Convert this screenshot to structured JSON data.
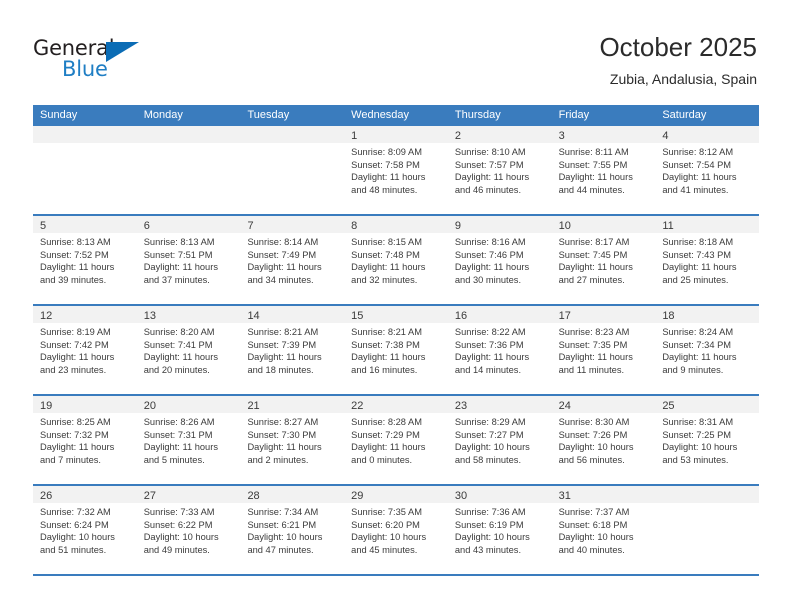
{
  "brand": {
    "name_top": "General",
    "name_bottom": "Blue",
    "triangle_icon": "triangle-icon",
    "color_dark": "#231f20",
    "color_blue": "#1f7ec4"
  },
  "header": {
    "title": "October 2025",
    "subtitle": "Zubia, Andalusia, Spain"
  },
  "theme": {
    "header_blue": "#3a7cbe",
    "daynum_strip": "#f2f2f2",
    "text": "#3b3b3b"
  },
  "weekdays": [
    "Sunday",
    "Monday",
    "Tuesday",
    "Wednesday",
    "Thursday",
    "Friday",
    "Saturday"
  ],
  "labels": {
    "sunrise": "Sunrise:",
    "sunset": "Sunset:",
    "daylight": "Daylight:"
  },
  "weeks": [
    [
      {
        "day": "",
        "lines": []
      },
      {
        "day": "",
        "lines": []
      },
      {
        "day": "",
        "lines": []
      },
      {
        "day": "1",
        "lines": [
          "Sunrise: 8:09 AM",
          "Sunset: 7:58 PM",
          "Daylight: 11 hours and 48 minutes."
        ]
      },
      {
        "day": "2",
        "lines": [
          "Sunrise: 8:10 AM",
          "Sunset: 7:57 PM",
          "Daylight: 11 hours and 46 minutes."
        ]
      },
      {
        "day": "3",
        "lines": [
          "Sunrise: 8:11 AM",
          "Sunset: 7:55 PM",
          "Daylight: 11 hours and 44 minutes."
        ]
      },
      {
        "day": "4",
        "lines": [
          "Sunrise: 8:12 AM",
          "Sunset: 7:54 PM",
          "Daylight: 11 hours and 41 minutes."
        ]
      }
    ],
    [
      {
        "day": "5",
        "lines": [
          "Sunrise: 8:13 AM",
          "Sunset: 7:52 PM",
          "Daylight: 11 hours and 39 minutes."
        ]
      },
      {
        "day": "6",
        "lines": [
          "Sunrise: 8:13 AM",
          "Sunset: 7:51 PM",
          "Daylight: 11 hours and 37 minutes."
        ]
      },
      {
        "day": "7",
        "lines": [
          "Sunrise: 8:14 AM",
          "Sunset: 7:49 PM",
          "Daylight: 11 hours and 34 minutes."
        ]
      },
      {
        "day": "8",
        "lines": [
          "Sunrise: 8:15 AM",
          "Sunset: 7:48 PM",
          "Daylight: 11 hours and 32 minutes."
        ]
      },
      {
        "day": "9",
        "lines": [
          "Sunrise: 8:16 AM",
          "Sunset: 7:46 PM",
          "Daylight: 11 hours and 30 minutes."
        ]
      },
      {
        "day": "10",
        "lines": [
          "Sunrise: 8:17 AM",
          "Sunset: 7:45 PM",
          "Daylight: 11 hours and 27 minutes."
        ]
      },
      {
        "day": "11",
        "lines": [
          "Sunrise: 8:18 AM",
          "Sunset: 7:43 PM",
          "Daylight: 11 hours and 25 minutes."
        ]
      }
    ],
    [
      {
        "day": "12",
        "lines": [
          "Sunrise: 8:19 AM",
          "Sunset: 7:42 PM",
          "Daylight: 11 hours and 23 minutes."
        ]
      },
      {
        "day": "13",
        "lines": [
          "Sunrise: 8:20 AM",
          "Sunset: 7:41 PM",
          "Daylight: 11 hours and 20 minutes."
        ]
      },
      {
        "day": "14",
        "lines": [
          "Sunrise: 8:21 AM",
          "Sunset: 7:39 PM",
          "Daylight: 11 hours and 18 minutes."
        ]
      },
      {
        "day": "15",
        "lines": [
          "Sunrise: 8:21 AM",
          "Sunset: 7:38 PM",
          "Daylight: 11 hours and 16 minutes."
        ]
      },
      {
        "day": "16",
        "lines": [
          "Sunrise: 8:22 AM",
          "Sunset: 7:36 PM",
          "Daylight: 11 hours and 14 minutes."
        ]
      },
      {
        "day": "17",
        "lines": [
          "Sunrise: 8:23 AM",
          "Sunset: 7:35 PM",
          "Daylight: 11 hours and 11 minutes."
        ]
      },
      {
        "day": "18",
        "lines": [
          "Sunrise: 8:24 AM",
          "Sunset: 7:34 PM",
          "Daylight: 11 hours and 9 minutes."
        ]
      }
    ],
    [
      {
        "day": "19",
        "lines": [
          "Sunrise: 8:25 AM",
          "Sunset: 7:32 PM",
          "Daylight: 11 hours and 7 minutes."
        ]
      },
      {
        "day": "20",
        "lines": [
          "Sunrise: 8:26 AM",
          "Sunset: 7:31 PM",
          "Daylight: 11 hours and 5 minutes."
        ]
      },
      {
        "day": "21",
        "lines": [
          "Sunrise: 8:27 AM",
          "Sunset: 7:30 PM",
          "Daylight: 11 hours and 2 minutes."
        ]
      },
      {
        "day": "22",
        "lines": [
          "Sunrise: 8:28 AM",
          "Sunset: 7:29 PM",
          "Daylight: 11 hours and 0 minutes."
        ]
      },
      {
        "day": "23",
        "lines": [
          "Sunrise: 8:29 AM",
          "Sunset: 7:27 PM",
          "Daylight: 10 hours and 58 minutes."
        ]
      },
      {
        "day": "24",
        "lines": [
          "Sunrise: 8:30 AM",
          "Sunset: 7:26 PM",
          "Daylight: 10 hours and 56 minutes."
        ]
      },
      {
        "day": "25",
        "lines": [
          "Sunrise: 8:31 AM",
          "Sunset: 7:25 PM",
          "Daylight: 10 hours and 53 minutes."
        ]
      }
    ],
    [
      {
        "day": "26",
        "lines": [
          "Sunrise: 7:32 AM",
          "Sunset: 6:24 PM",
          "Daylight: 10 hours and 51 minutes."
        ]
      },
      {
        "day": "27",
        "lines": [
          "Sunrise: 7:33 AM",
          "Sunset: 6:22 PM",
          "Daylight: 10 hours and 49 minutes."
        ]
      },
      {
        "day": "28",
        "lines": [
          "Sunrise: 7:34 AM",
          "Sunset: 6:21 PM",
          "Daylight: 10 hours and 47 minutes."
        ]
      },
      {
        "day": "29",
        "lines": [
          "Sunrise: 7:35 AM",
          "Sunset: 6:20 PM",
          "Daylight: 10 hours and 45 minutes."
        ]
      },
      {
        "day": "30",
        "lines": [
          "Sunrise: 7:36 AM",
          "Sunset: 6:19 PM",
          "Daylight: 10 hours and 43 minutes."
        ]
      },
      {
        "day": "31",
        "lines": [
          "Sunrise: 7:37 AM",
          "Sunset: 6:18 PM",
          "Daylight: 10 hours and 40 minutes."
        ]
      },
      {
        "day": "",
        "lines": []
      }
    ]
  ]
}
